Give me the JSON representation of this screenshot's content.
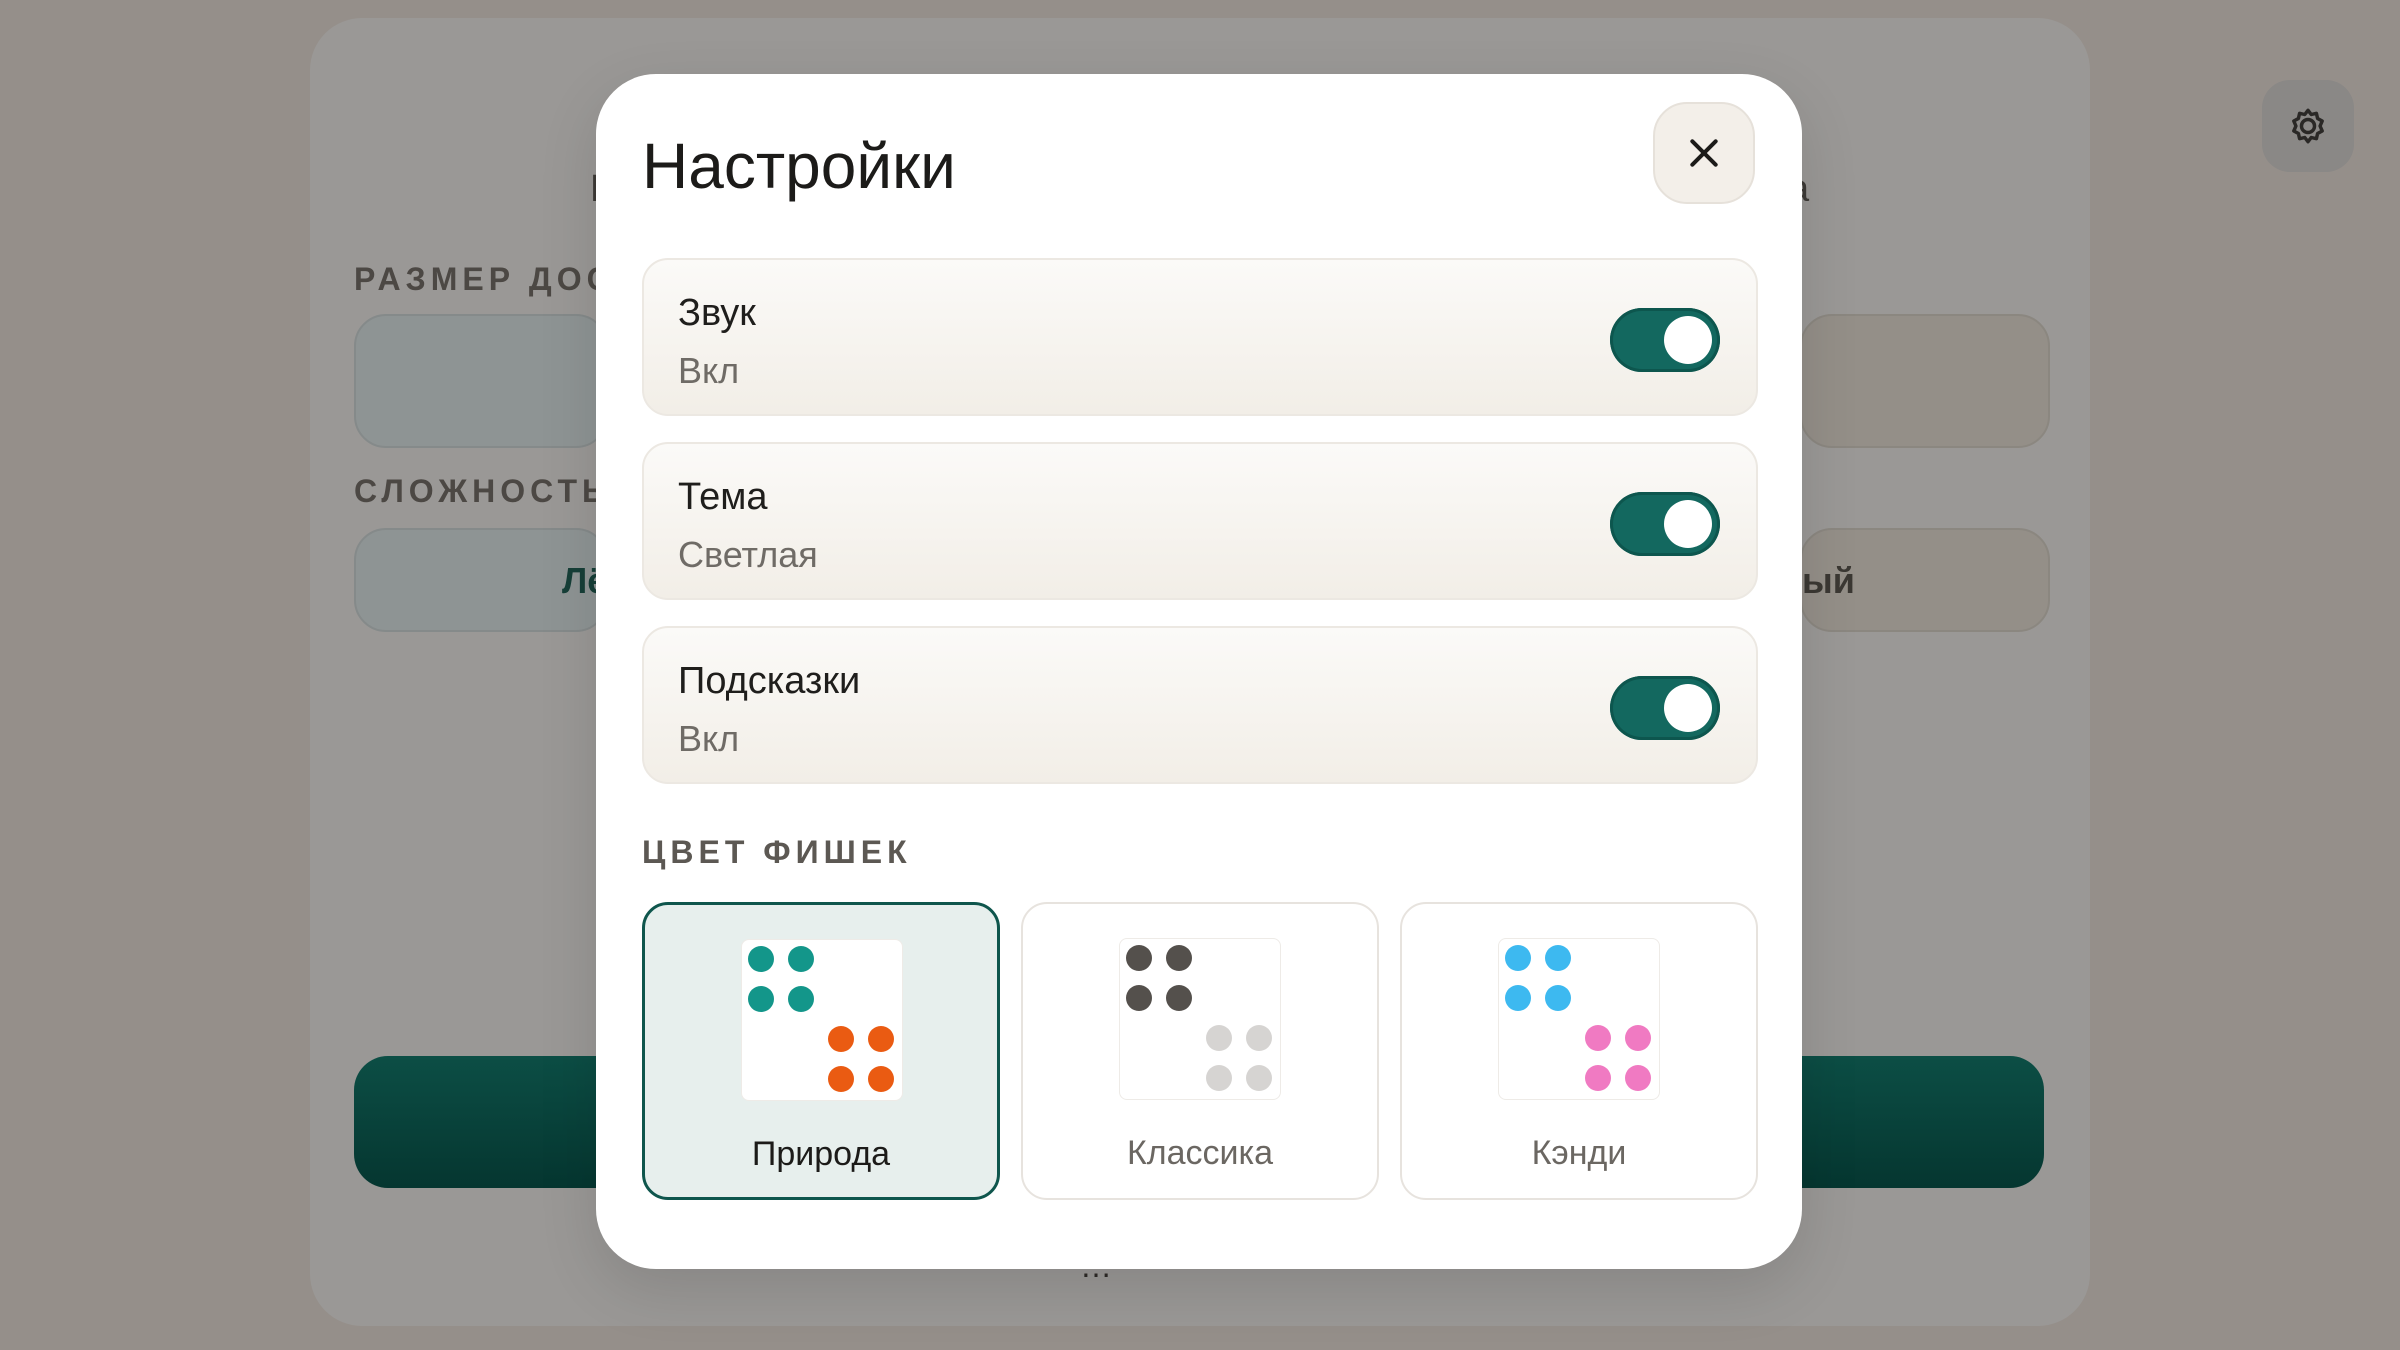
{
  "background": {
    "title_fragments": [
      "Н",
      "а"
    ],
    "board_size_label": "РАЗМЕР ДОСК",
    "difficulty_label": "СЛОЖНОСТЬ",
    "difficulty_left": "Лё",
    "difficulty_right": "ый",
    "bottom_text": "…"
  },
  "dialog": {
    "title": "Настройки",
    "settings": [
      {
        "name": "Звук",
        "value": "Вкл",
        "on": true
      },
      {
        "name": "Тема",
        "value": "Светлая",
        "on": true
      },
      {
        "name": "Подсказки",
        "value": "Вкл",
        "on": true
      }
    ],
    "piece_color_label": "ЦВЕТ ФИШЕК",
    "palettes": [
      {
        "label": "Природа",
        "selected": true,
        "color_a": "#13968a",
        "color_b": "#ea5b12"
      },
      {
        "label": "Классика",
        "selected": false,
        "color_a": "#54504c",
        "color_b": "#d6d4d2"
      },
      {
        "label": "Кэнди",
        "selected": false,
        "color_a": "#3db9f0",
        "color_b": "#f07ac2"
      }
    ]
  },
  "colors": {
    "accent": "#13685f",
    "overlay": "#958f8a"
  }
}
